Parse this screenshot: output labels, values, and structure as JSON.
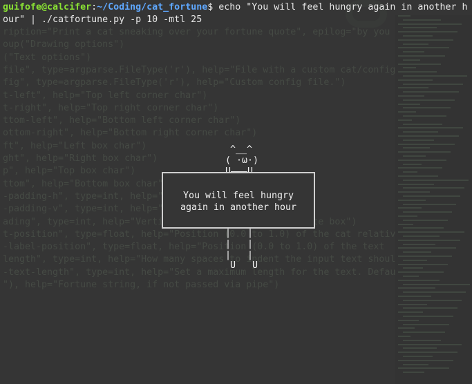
{
  "prompt": {
    "user_host": "guifofe@calcifer",
    "separator": ":",
    "path": "~/Coding/cat_fortune",
    "symbol": "$",
    "command_line1": " echo \"You will feel hungry again in another h",
    "command_line2": "our\" | ./catfortune.py -p 10 -mtl 25"
  },
  "ghost_code": [
    "ription=\"Print a cat sneaking over your fortune quote\", epilog=\"by you",
    "oup(\"Drawing options\")",
    "(\"Text options\")",
    "file\", type=argparse.FileType('r'), help=\"File with a custom cat/config",
    "fig\", type=argparse.FileType('r'), help=\"Custom config file.\")",
    "t-left\", help=\"Top left corner char\")",
    "t-right\", help=\"Top right corner char\")",
    "ttom-left\", help=\"Bottom left corner char\")",
    "ottom-right\", help=\"Bottom right corner char\")",
    "ft\", help=\"Left box char\")",
    "ght\", help=\"Right box char\")",
    "p\", help=\"Top box char\")",
    "ttom\", help=\"Bottom box char\")",
    "-padding-h\", type=int, help=\"Horizontal text padding\")",
    "-padding-v\", type=int, help=\"Vertical text padding\")",
    "ading\", type=int, help=\"Vertical text padding of the quote box\")",
    "t-position\", type=float, help=\"Position (0.0 to 1.0) of the cat relative",
    "-label-position\", type=float, help=\"Position (0.0 to 1.0) of the text",
    "length\", type=int, help=\"How many spaces to indent the input text should",
    "-text-length\", type=int, help=\"Set a maximum length for the text. Default",
    "\"), help=\"Fortune string, if not passed via pipe\")"
  ],
  "cat": {
    "ears": "^__^",
    "face": "( ·ω·)",
    "paws_top": "U———U",
    "legs": "|   |",
    "feet": "U   U"
  },
  "fortune": {
    "line1": "You will feel hungry",
    "line2": "again in another hour"
  },
  "colors": {
    "background": "#353535",
    "prompt_user": "#8ae234",
    "prompt_path": "#5fa8ff",
    "text": "#e8e8e8"
  }
}
